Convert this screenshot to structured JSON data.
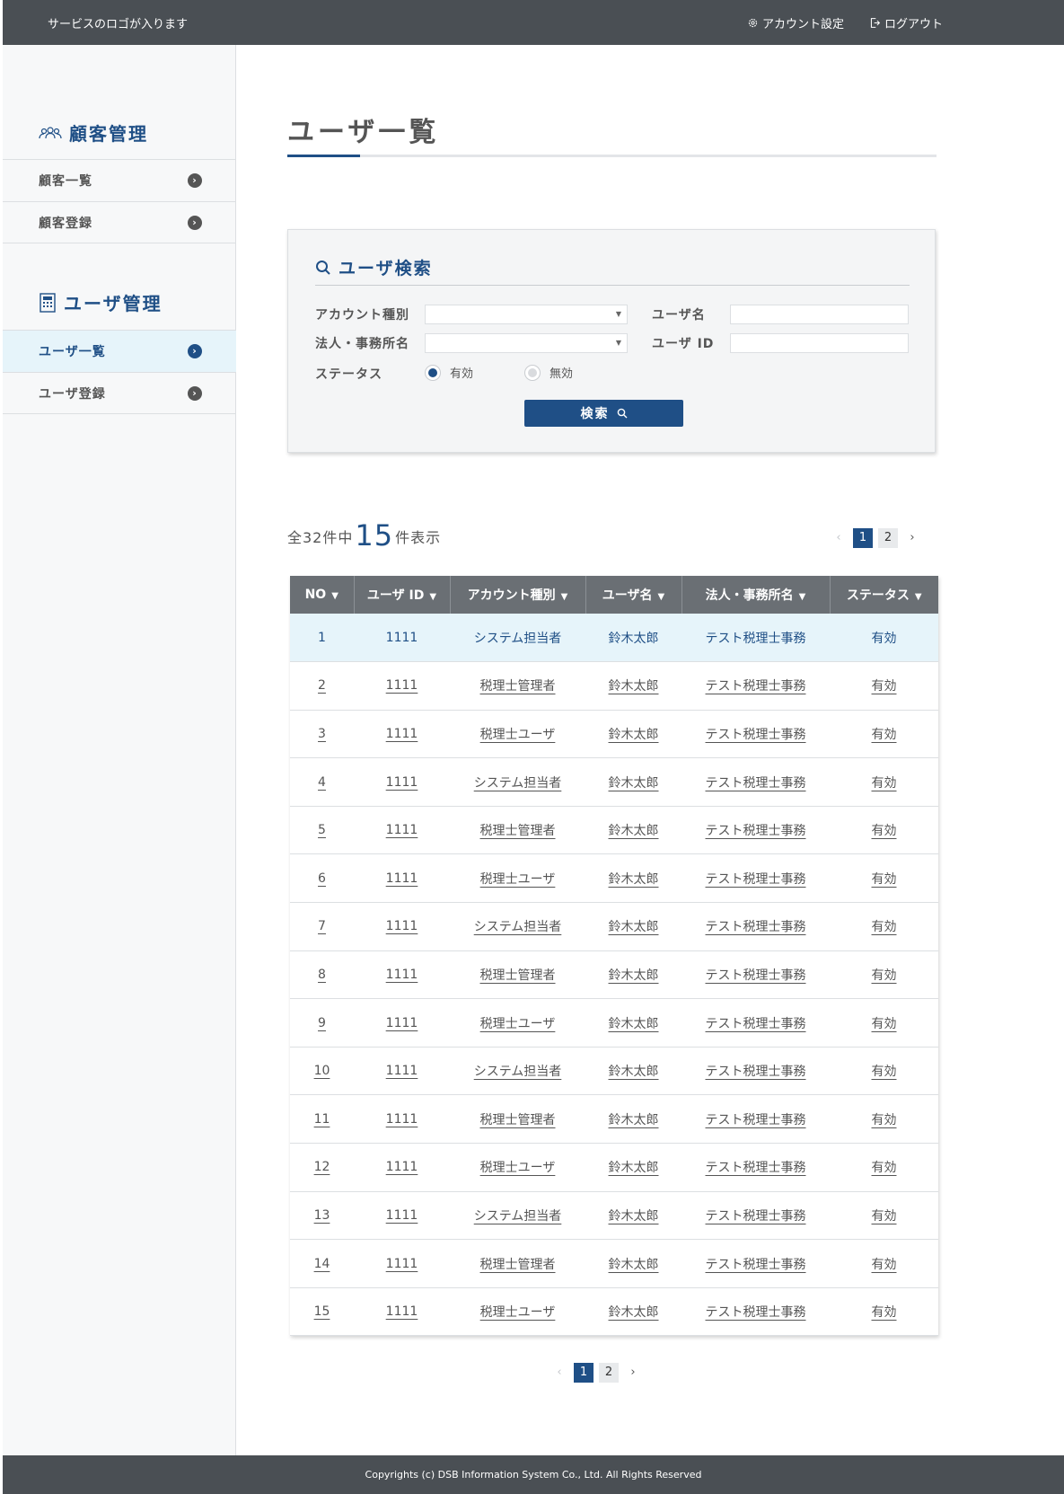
{
  "header": {
    "logo_text": "サービスのロゴが入ります",
    "account_settings": "アカウント設定",
    "logout": "ログアウト"
  },
  "sidebar": {
    "sections": [
      {
        "title": "顧客管理",
        "icon": "people-icon",
        "items": [
          {
            "label": "顧客一覧"
          },
          {
            "label": "顧客登録"
          }
        ]
      },
      {
        "title": "ユーザ管理",
        "icon": "calculator-icon",
        "items": [
          {
            "label": "ユーザ一覧",
            "active": true
          },
          {
            "label": "ユーザ登録"
          }
        ]
      }
    ]
  },
  "main": {
    "page_title": "ユーザ一覧",
    "search": {
      "title": "ユーザ検索",
      "account_type_label": "アカウント種別",
      "account_type_value": "",
      "company_label": "法人・事務所名",
      "company_value": "",
      "username_label": "ユーザ名",
      "username_value": "",
      "userid_label": "ユーザ ID",
      "userid_value": "",
      "status_label": "ステータス",
      "status_options": [
        "有効",
        "無効"
      ],
      "status_selected": "有効",
      "button_label": "検索"
    },
    "result": {
      "prefix": "全32件中",
      "shown": "15",
      "suffix": "件表示"
    },
    "pagination": {
      "prev": "‹",
      "next": "›",
      "pages": [
        "1",
        "2"
      ],
      "current": "1"
    },
    "table": {
      "columns": [
        "NO",
        "ユーザ ID",
        "アカウント種別",
        "ユーザ名",
        "法人・事務所名",
        "ステータス"
      ],
      "rows": [
        [
          "1",
          "1111",
          "システム担当者",
          "鈴木太郎",
          "テスト税理士事務",
          "有効"
        ],
        [
          "2",
          "1111",
          "税理士管理者",
          "鈴木太郎",
          "テスト税理士事務",
          "有効"
        ],
        [
          "3",
          "1111",
          "税理士ユーザ",
          "鈴木太郎",
          "テスト税理士事務",
          "有効"
        ],
        [
          "4",
          "1111",
          "システム担当者",
          "鈴木太郎",
          "テスト税理士事務",
          "有効"
        ],
        [
          "5",
          "1111",
          "税理士管理者",
          "鈴木太郎",
          "テスト税理士事務",
          "有効"
        ],
        [
          "6",
          "1111",
          "税理士ユーザ",
          "鈴木太郎",
          "テスト税理士事務",
          "有効"
        ],
        [
          "7",
          "1111",
          "システム担当者",
          "鈴木太郎",
          "テスト税理士事務",
          "有効"
        ],
        [
          "8",
          "1111",
          "税理士管理者",
          "鈴木太郎",
          "テスト税理士事務",
          "有効"
        ],
        [
          "9",
          "1111",
          "税理士ユーザ",
          "鈴木太郎",
          "テスト税理士事務",
          "有効"
        ],
        [
          "10",
          "1111",
          "システム担当者",
          "鈴木太郎",
          "テスト税理士事務",
          "有効"
        ],
        [
          "11",
          "1111",
          "税理士管理者",
          "鈴木太郎",
          "テスト税理士事務",
          "有効"
        ],
        [
          "12",
          "1111",
          "税理士ユーザ",
          "鈴木太郎",
          "テスト税理士事務",
          "有効"
        ],
        [
          "13",
          "1111",
          "システム担当者",
          "鈴木太郎",
          "テスト税理士事務",
          "有効"
        ],
        [
          "14",
          "1111",
          "税理士管理者",
          "鈴木太郎",
          "テスト税理士事務",
          "有効"
        ],
        [
          "15",
          "1111",
          "税理士ユーザ",
          "鈴木太郎",
          "テスト税理士事務",
          "有効"
        ]
      ]
    }
  },
  "footer": {
    "copyright": "Copyrights (c) DSB Information System Co., Ltd. All Rights Reserved"
  },
  "colors": {
    "accent": "#1f4f86",
    "header_bg": "#4a4f54",
    "highlight_row": "#e6f4fa"
  }
}
